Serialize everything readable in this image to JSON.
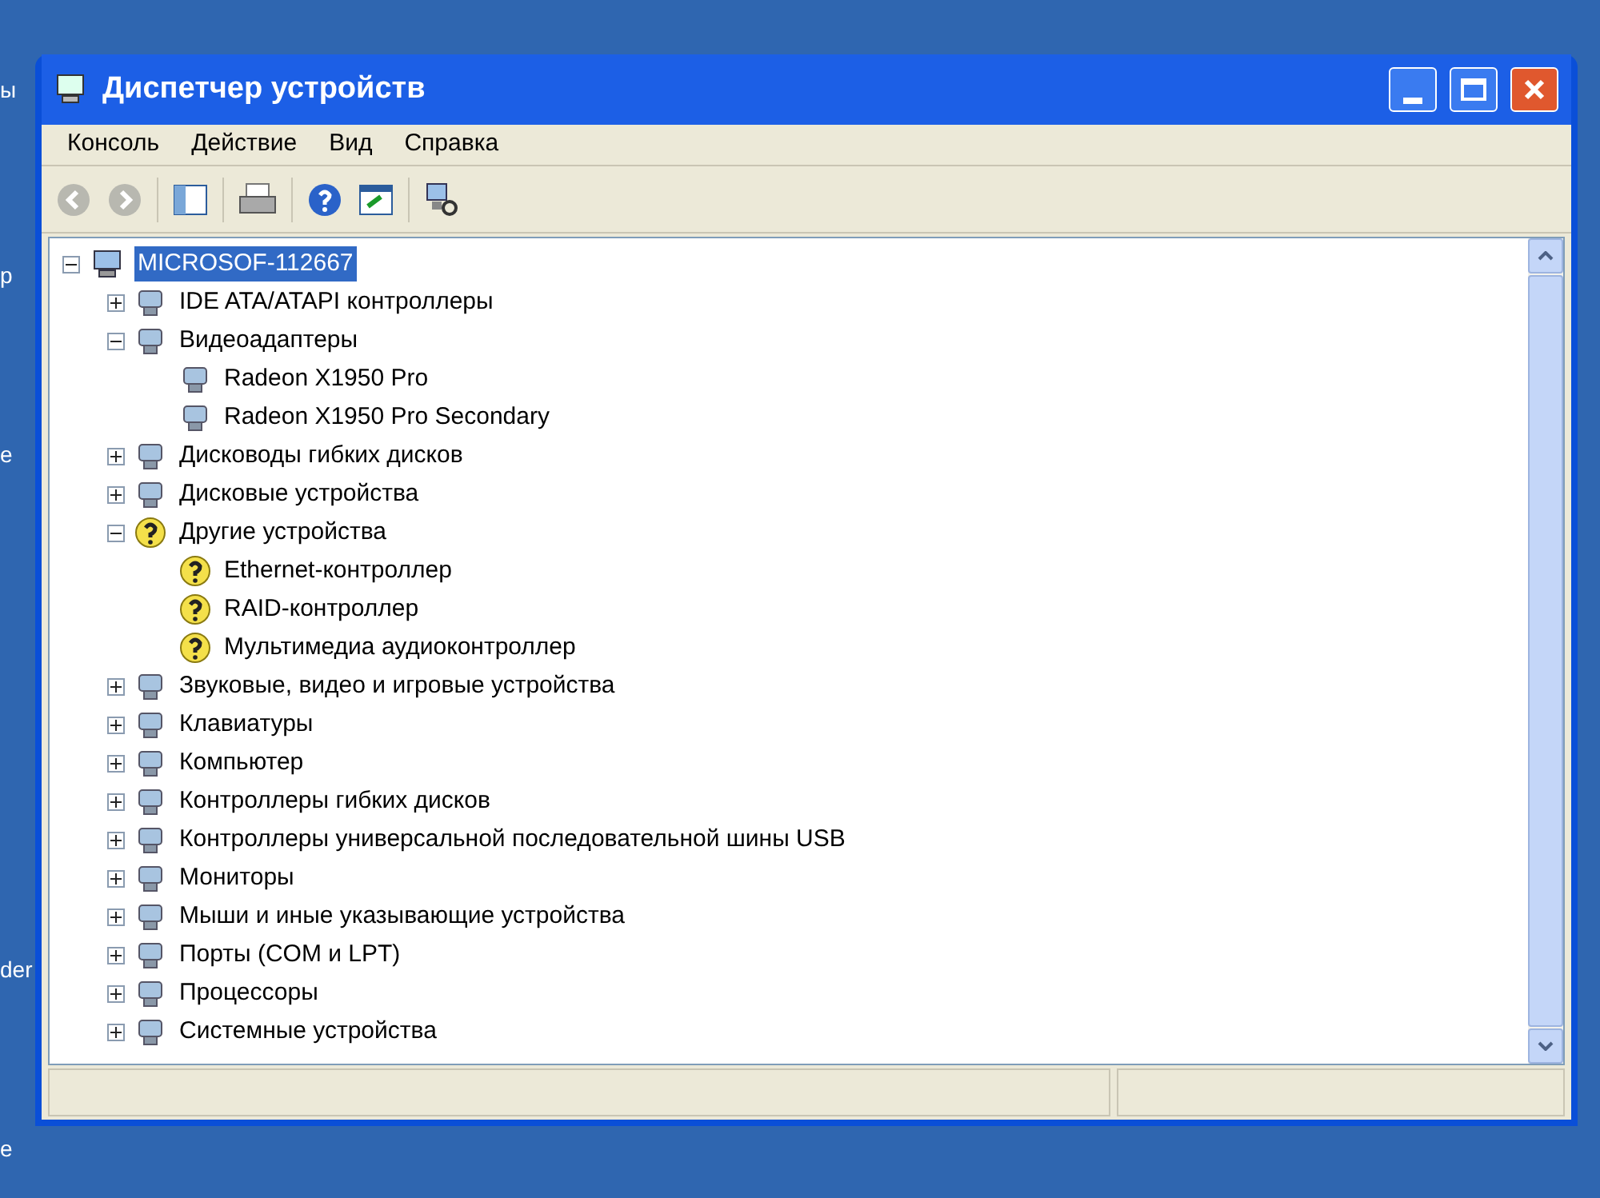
{
  "desktop_labels": [
    "ы",
    "р",
    "е",
    "der",
    "е"
  ],
  "window": {
    "title": "Диспетчер устройств"
  },
  "menu": [
    "Консоль",
    "Действие",
    "Вид",
    "Справка"
  ],
  "tree": {
    "label": "MICROSOF-112667",
    "kind": "computer",
    "expanded": true,
    "selected": true,
    "children": [
      {
        "label": "IDE ATA/ATAPI контроллеры",
        "kind": "device",
        "expanded": false,
        "selected": false
      },
      {
        "label": "Видеоадаптеры",
        "kind": "device",
        "expanded": true,
        "selected": false,
        "children": [
          {
            "label": "Radeon X1950 Pro",
            "kind": "device",
            "selected": false
          },
          {
            "label": "Radeon X1950 Pro Secondary",
            "kind": "device",
            "selected": false
          }
        ]
      },
      {
        "label": "Дисководы гибких дисков",
        "kind": "device",
        "expanded": false,
        "selected": false
      },
      {
        "label": "Дисковые устройства",
        "kind": "device",
        "expanded": false,
        "selected": false
      },
      {
        "label": "Другие устройства",
        "kind": "unknown",
        "expanded": true,
        "selected": false,
        "children": [
          {
            "label": "Ethernet-контроллер",
            "kind": "unknown",
            "selected": false
          },
          {
            "label": "RAID-контроллер",
            "kind": "unknown",
            "selected": false
          },
          {
            "label": "Мультимедиа аудиоконтроллер",
            "kind": "unknown",
            "selected": false
          }
        ]
      },
      {
        "label": "Звуковые, видео и игровые устройства",
        "kind": "device",
        "expanded": false,
        "selected": false
      },
      {
        "label": "Клавиатуры",
        "kind": "device",
        "expanded": false,
        "selected": false
      },
      {
        "label": "Компьютер",
        "kind": "device",
        "expanded": false,
        "selected": false
      },
      {
        "label": "Контроллеры гибких дисков",
        "kind": "device",
        "expanded": false,
        "selected": false
      },
      {
        "label": "Контроллеры универсальной последовательной шины USB",
        "kind": "device",
        "expanded": false,
        "selected": false
      },
      {
        "label": "Мониторы",
        "kind": "device",
        "expanded": false,
        "selected": false
      },
      {
        "label": "Мыши и иные указывающие устройства",
        "kind": "device",
        "expanded": false,
        "selected": false
      },
      {
        "label": "Порты (COM и LPT)",
        "kind": "device",
        "expanded": false,
        "selected": false
      },
      {
        "label": "Процессоры",
        "kind": "device",
        "expanded": false,
        "selected": false
      },
      {
        "label": "Системные устройства",
        "kind": "device",
        "expanded": false,
        "selected": false
      }
    ]
  }
}
